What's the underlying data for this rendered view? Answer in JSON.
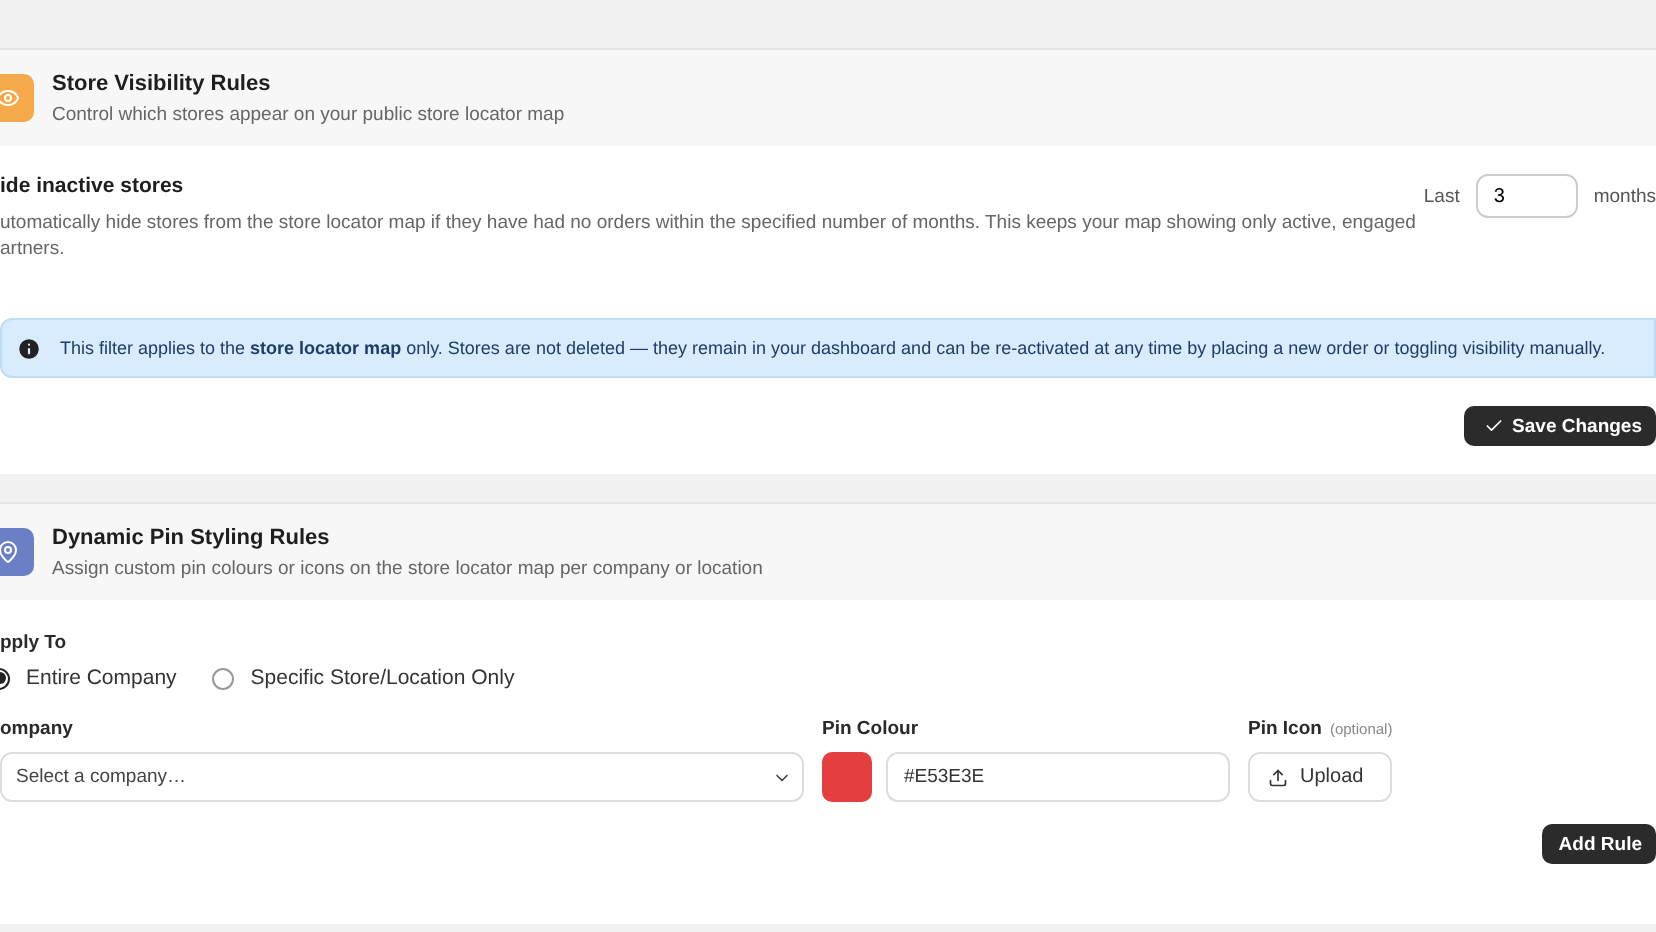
{
  "visibility": {
    "title": "Store Visibility Rules",
    "subtitle": "Control which stores appear on your public store locator map",
    "setting_title": "ide inactive stores",
    "setting_description": "utomatically hide stores from the store locator map if they have had no orders within the specified number of months. This keeps your map showing only active, engaged artners.",
    "prefix": "Last",
    "months_value": "3",
    "suffix": "months",
    "info": "This filter applies to the **store locator map** only. Stores are not deleted — they remain in your dashboard and can be re-activated at any time by placing a new order or toggling visibility manually.",
    "save_button": "Save Changes"
  },
  "pin_styling": {
    "title": "Dynamic Pin Styling Rules",
    "subtitle": "Assign custom pin colours or icons on the store locator map per company or location",
    "apply_label": "pply To",
    "options": [
      {
        "label": "Entire Company",
        "selected": true
      },
      {
        "label": "Specific Store/Location Only",
        "selected": false
      }
    ],
    "company_label": "ompany",
    "company_placeholder": "Select a company…",
    "colour_label": "Pin Colour",
    "colour_value": "#E53E3E",
    "icon_label": "Pin Icon",
    "icon_hint": "(optional)",
    "upload_button": "Upload",
    "add_button": "Add Rule"
  }
}
